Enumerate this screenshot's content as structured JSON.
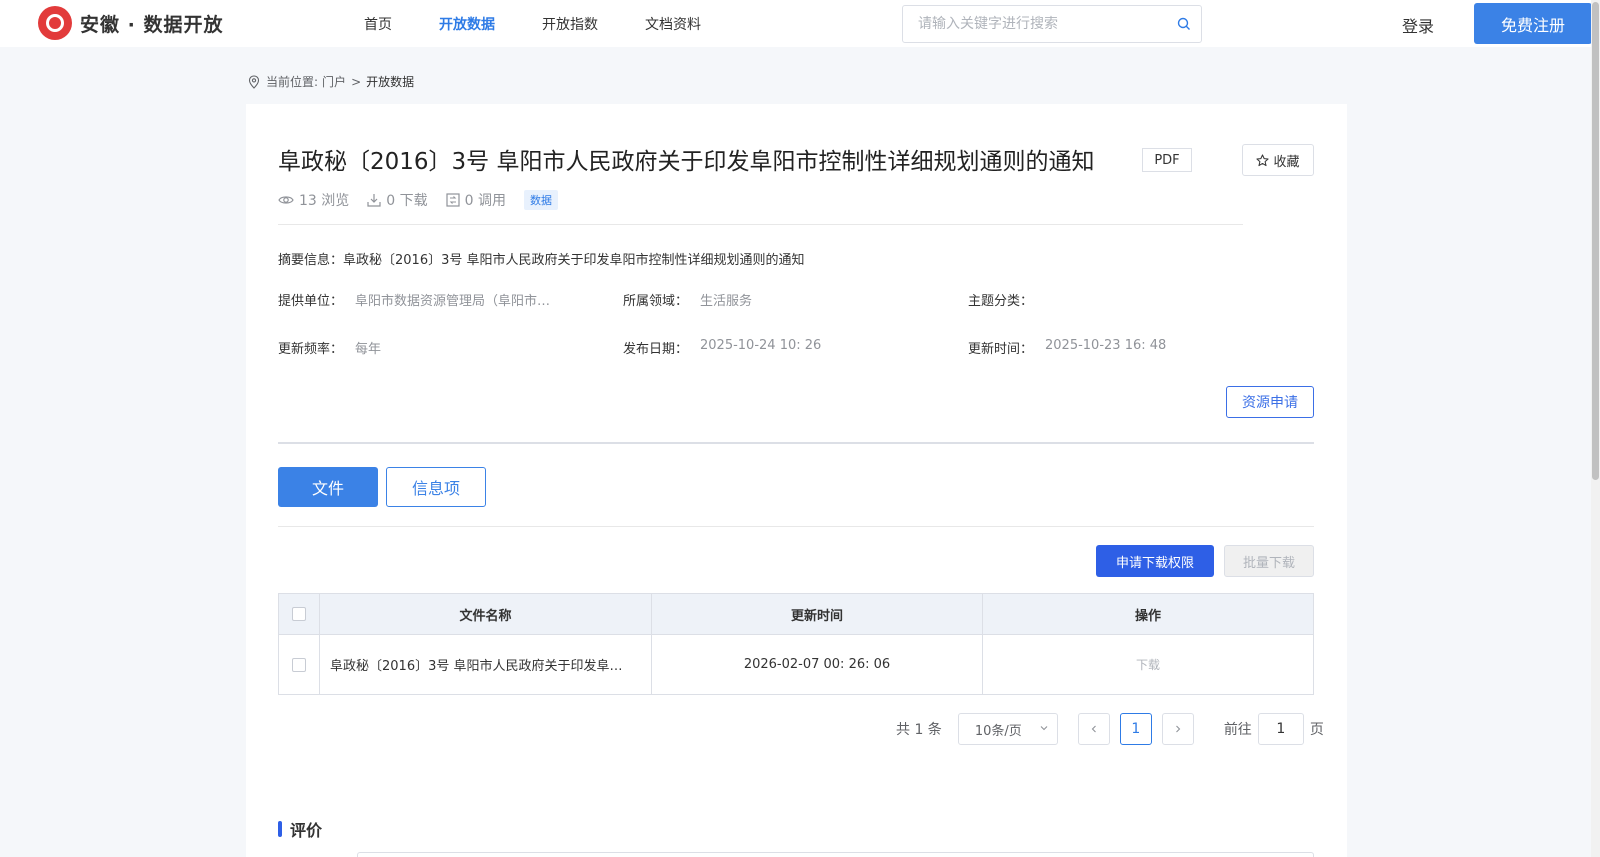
{
  "header": {
    "logo_text": "安徽 · 数据开放",
    "nav": [
      {
        "label": "首页",
        "active": false
      },
      {
        "label": "开放数据",
        "active": true
      },
      {
        "label": "开放指数",
        "active": false
      },
      {
        "label": "文档资料",
        "active": false
      }
    ],
    "search_placeholder": "请输入关键字进行搜索",
    "login": "登录",
    "register": "免费注册"
  },
  "breadcrumb": {
    "prefix": "当前位置:",
    "home": "门户",
    "separator": ">",
    "current": "开放数据"
  },
  "detail": {
    "title": "阜政秘〔2016〕3号 阜阳市人民政府关于印发阜阳市控制性详细规划通则的通知",
    "format": "PDF",
    "favorite": "收藏",
    "stats": {
      "views": "13 浏览",
      "downloads": "0 下载",
      "calls": "0 调用"
    },
    "tag": "数据",
    "summary": "摘要信息：阜政秘〔2016〕3号 阜阳市人民政府关于印发阜阳市控制性详细规划通则的通知",
    "meta": {
      "provider_label": "提供单位：",
      "provider_value": "阜阳市数据资源管理局（阜阳市…",
      "domain_label": "所属领域：",
      "domain_value": "生活服务",
      "topic_label": "主题分类：",
      "topic_value": "",
      "frequency_label": "更新频率：",
      "frequency_value": "每年",
      "publish_label": "发布日期：",
      "publish_value": "2025-10-24 10: 26",
      "update_label": "更新时间：",
      "update_value": "2025-10-23 16: 48"
    },
    "apply_button": "资源申请"
  },
  "tabs": {
    "file": "文件",
    "info": "信息项"
  },
  "actions": {
    "request_download": "申请下载权限",
    "batch_download": "批量下载"
  },
  "table": {
    "headers": {
      "name": "文件名称",
      "time": "更新时间",
      "operation": "操作"
    },
    "rows": [
      {
        "name": "阜政秘〔2016〕3号 阜阳市人民政府关于印发阜…",
        "time": "2026-02-07 00: 26: 06",
        "operation": "下载"
      }
    ]
  },
  "pagination": {
    "total": "共 1 条",
    "page_size": "10条/页",
    "current_page": "1",
    "goto_label": "前往",
    "goto_value": "1",
    "page_unit": "页"
  },
  "rating": {
    "title": "评价"
  },
  "colors": {
    "accent": "#3b82e6",
    "primary_dark": "#2e5fe6",
    "logo_red": "#e23b3b"
  }
}
